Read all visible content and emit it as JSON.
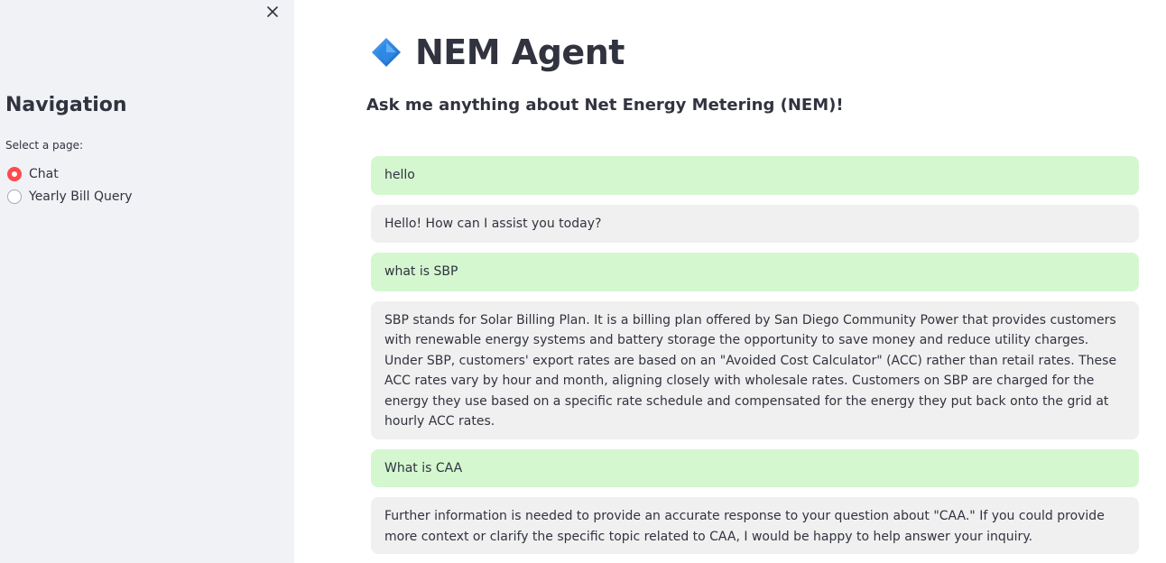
{
  "sidebar": {
    "title": "Navigation",
    "radio_label": "Select a page:",
    "options": [
      {
        "label": "Chat",
        "selected": true
      },
      {
        "label": "Yearly Bill Query",
        "selected": false
      }
    ],
    "close_icon": "close-icon"
  },
  "main": {
    "title": "NEM Agent",
    "title_icon": "blue-diamond-icon",
    "subtitle": "Ask me anything about Net Energy Metering (NEM)!",
    "messages": [
      {
        "role": "user",
        "text": "hello"
      },
      {
        "role": "assistant",
        "text": "Hello! How can I assist you today?"
      },
      {
        "role": "user",
        "text": "what is SBP"
      },
      {
        "role": "assistant",
        "text": "SBP stands for Solar Billing Plan. It is a billing plan offered by San Diego Community Power that provides customers with renewable energy systems and battery storage the opportunity to save money and reduce utility charges. Under SBP, customers' export rates are based on an \"Avoided Cost Calculator\" (ACC) rather than retail rates. These ACC rates vary by hour and month, aligning closely with wholesale rates. Customers on SBP are charged for the energy they use based on a specific rate schedule and compensated for the energy they put back onto the grid at hourly ACC rates."
      },
      {
        "role": "user",
        "text": "What is CAA"
      },
      {
        "role": "assistant",
        "text": "Further information is needed to provide an accurate response to your question about \"CAA.\" If you could provide more context or clarify the specific topic related to CAA, I would be happy to help answer your inquiry."
      }
    ]
  },
  "colors": {
    "sidebar_bg": "#f0f2f6",
    "user_bubble": "#d4f7d0",
    "assistant_bubble": "#f0f0f0",
    "radio_accent": "#ff4b4b",
    "diamond": "#1e88e5"
  }
}
